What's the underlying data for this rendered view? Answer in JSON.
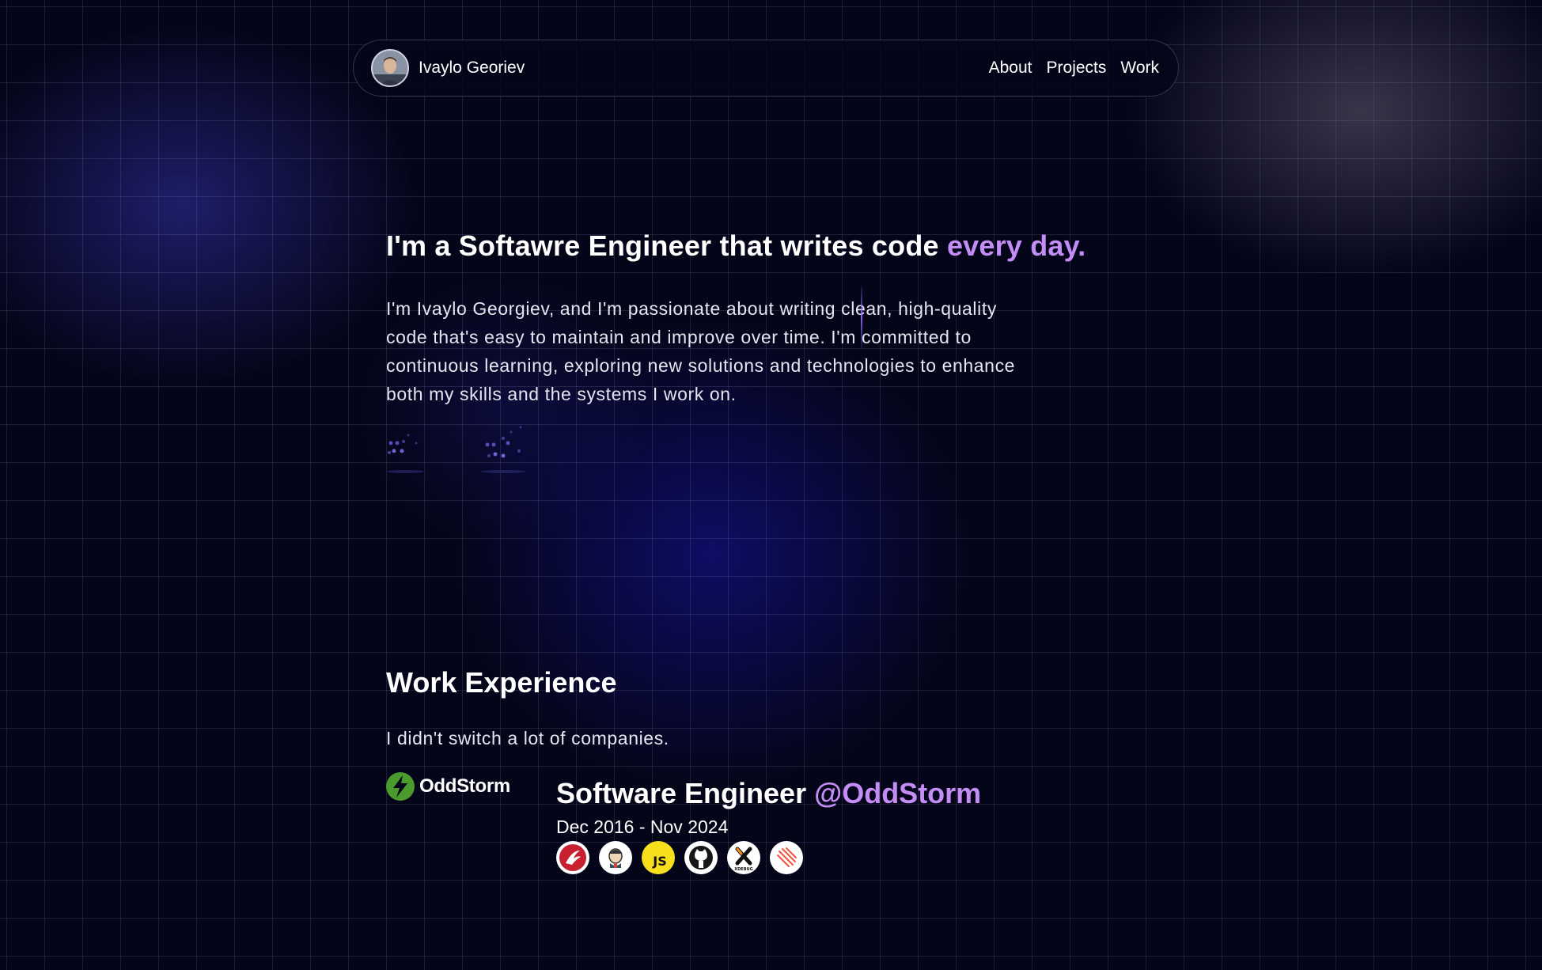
{
  "nav": {
    "name": "Ivaylo Georiev",
    "links": [
      "About",
      "Projects",
      "Work"
    ]
  },
  "hero": {
    "title": "I'm a Softawre Engineer that writes code",
    "title_accent": "every day.",
    "description": "I'm Ivaylo Georgiev, and I'm passionate about writing clean, high-quality code that's easy to maintain and improve over time. I'm committed to continuous learning, exploring new solutions and technologies to enhance both my skills and the systems I work on."
  },
  "work": {
    "title": "Work Experience",
    "subtitle": "I didn't switch a lot of companies.",
    "jobs": [
      {
        "company": "OddStorm",
        "role": "Software Engineer",
        "at": "@OddStorm",
        "dates": "Dec 2016 - Nov 2024",
        "tech": [
          "laminas-icon",
          "jenkins-icon",
          "javascript-icon",
          "github-icon",
          "xdebug-icon",
          "laravel-icon"
        ],
        "tech_labels": {
          "javascript": "JS",
          "xdebug": "XDEBUG"
        }
      }
    ]
  },
  "colors": {
    "background": "#05051a",
    "accent": "#c48cf5",
    "text": "#ffffff",
    "grid": "#2a2a4a"
  }
}
